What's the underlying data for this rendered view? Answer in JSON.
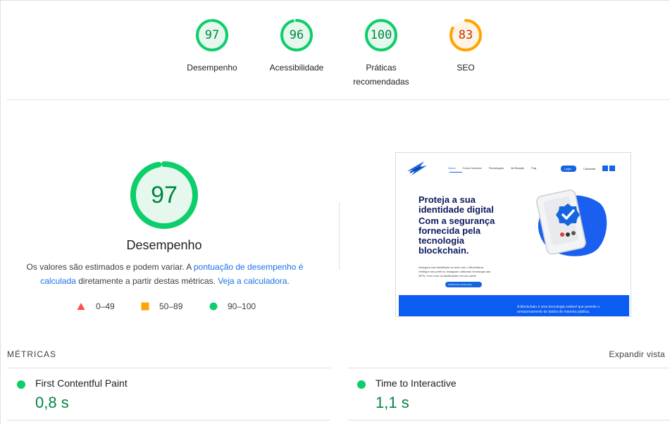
{
  "colors": {
    "pass": "#0cce6b",
    "pass_text": "#018642",
    "pass_fill": "#e6f8ee",
    "average": "#ffa400",
    "average_text": "#c33300",
    "average_fill": "#fff4e5",
    "fail": "#ff4e42",
    "link": "#1a73e8"
  },
  "categories": [
    {
      "score": "97",
      "value": 97,
      "label": "Desempenho",
      "status": "pass"
    },
    {
      "score": "96",
      "value": 96,
      "label": "Acessibilidade",
      "status": "pass"
    },
    {
      "score": "100",
      "value": 100,
      "label_line1": "Práticas",
      "label_line2": "recomendadas",
      "status": "pass"
    },
    {
      "score": "83",
      "value": 83,
      "label": "SEO",
      "status": "average"
    }
  ],
  "performance": {
    "score": "97",
    "value": 97,
    "title": "Desempenho",
    "desc_part1": "Os valores são estimados e podem variar. A ",
    "desc_link1": "pontuação de desempenho é calculada",
    "desc_part2": " diretamente a partir destas métricas. ",
    "desc_link2": "Veja a calculadora",
    "desc_part3": "."
  },
  "legend": {
    "fail": "0–49",
    "average": "50–89",
    "pass": "90–100"
  },
  "screenshot": {
    "nav": [
      "Home",
      "Como funciona",
      "Tecnologias",
      "Verificação",
      "Faq"
    ],
    "login": "Login",
    "signup": "Cadastrar",
    "headline1": "Proteja a sua",
    "headline2": "identidade digital",
    "headline3": "Com a segurança",
    "headline4": "fornecida pela",
    "headline5": "tecnologia",
    "headline6": "blockchain.",
    "body1": "Assegura sua identidade na rede com o Blueshamp.",
    "body2": "Verifique seu perfil no Instagram utilizando tecnologia das",
    "body3": "NFTs. Fuce com os falsificações em seu perfil.",
    "cta": "Verificar Meu Perfil Agora",
    "footer1": "A blockchain é uma tecnologia notável que permite o",
    "footer2": "armazenamento de dados de maneira pública,"
  },
  "metrics": {
    "title": "MÉTRICAS",
    "expand": "Expandir vista",
    "items": [
      {
        "name": "First Contentful Paint",
        "value": "0,8 s"
      },
      {
        "name": "Time to Interactive",
        "value": "1,1 s"
      }
    ]
  }
}
